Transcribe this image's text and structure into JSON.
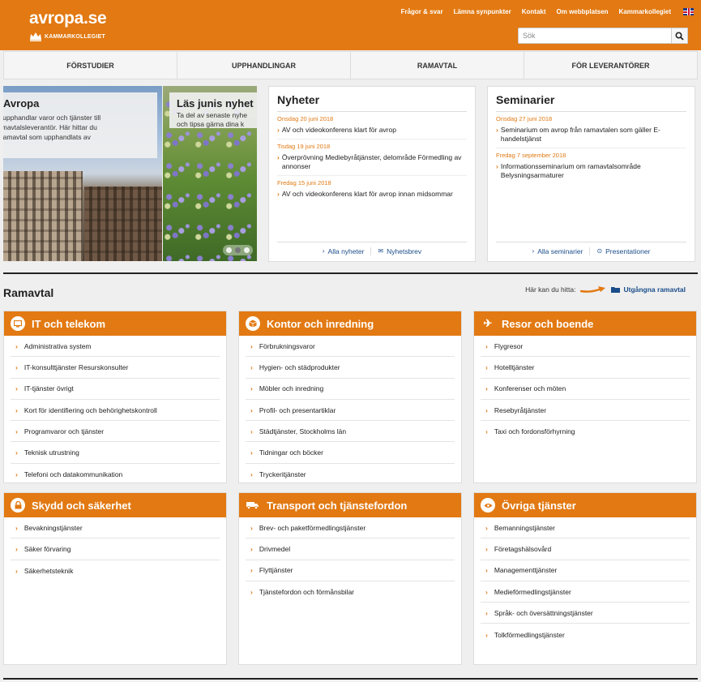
{
  "header": {
    "logo_title": "avropa.se",
    "logo_subtitle": "KAMMARKOLLEGIET",
    "top_links": [
      "Frågor & svar",
      "Lämna synpunkter",
      "Kontakt",
      "Om webbplatsen",
      "Kammarkollegiet"
    ],
    "search_placeholder": "Sök",
    "brand_color": "#e27912"
  },
  "nav": [
    "FÖRSTUDIER",
    "UPPHANDLINGAR",
    "RAMAVTAL",
    "FÖR LEVERANTÖRER"
  ],
  "hero": {
    "slide1_title": "Avropa",
    "slide1_lines": [
      "om upphandlar varor och tjänster till",
      "r ramavtalsleverantör. Här hittar du",
      "ga ramavtal som upphandlats av"
    ],
    "slide2_title": "Läs junis nyhet",
    "slide2_lines": [
      "Ta del av senaste nyhe",
      "och tipsa gärna dina k"
    ]
  },
  "news": {
    "title": "Nyheter",
    "items": [
      {
        "date": "Onsdag 20 juni 2018",
        "text": "AV och videokonferens klart för avrop"
      },
      {
        "date": "Tisdag 19 juni 2018",
        "text": "Överprövning Mediebyråtjänster, delområde Förmedling av annonser"
      },
      {
        "date": "Fredag 15 juni 2018",
        "text": "AV och videokonferens klart för avrop innan midsommar"
      }
    ],
    "footer_links": [
      "Alla nyheter",
      "Nyhetsbrev"
    ]
  },
  "seminars": {
    "title": "Seminarier",
    "items": [
      {
        "date": "Onsdag 27 juni 2018",
        "text": "Seminarium om avrop från ramavtalen som gäller E-handelstjänst"
      },
      {
        "date": "Fredag 7 september 2018",
        "text": "Informationsseminarium om ramavtalsområde Belysningsarmaturer"
      }
    ],
    "footer_links": [
      "Alla seminarier",
      "Presentationer"
    ]
  },
  "ramavtal": {
    "title": "Ramavtal",
    "hint_label": "Här kan du hitta:",
    "hint_link": "Utgångna ramavtal",
    "categories": [
      {
        "title": "IT och telekom",
        "icon": "monitor-icon",
        "items": [
          "Administrativa system",
          "IT-konsulttjänster Resurskonsulter",
          "IT-tjänster övrigt",
          "Kort för identifiering och behörighetskontroll",
          "Programvaror och tjänster",
          "Teknisk utrustning",
          "Telefoni och datakommunikation"
        ]
      },
      {
        "title": "Kontor och inredning",
        "icon": "box-icon",
        "items": [
          "Förbrukningsvaror",
          "Hygien- och städprodukter",
          "Möbler och inredning",
          "Profil- och presentartiklar",
          "Städtjänster, Stockholms län",
          "Tidningar och böcker",
          "Tryckeritjänster"
        ]
      },
      {
        "title": "Resor och boende",
        "icon": "airplane-icon",
        "items": [
          "Flygresor",
          "Hotelltjänster",
          "Konferenser och möten",
          "Resebyråtjänster",
          "Taxi och fordonsförhyrning"
        ]
      },
      {
        "title": "Skydd och säkerhet",
        "icon": "lock-icon",
        "items": [
          "Bevakningstjänster",
          "Säker förvaring",
          "Säkerhetsteknik"
        ]
      },
      {
        "title": "Transport och tjänstefordon",
        "icon": "truck-icon",
        "items": [
          "Brev- och paketförmedlingstjänster",
          "Drivmedel",
          "Flyttjänster",
          "Tjänstefordon och förmånsbilar"
        ]
      },
      {
        "title": "Övriga tjänster",
        "icon": "eye-icon",
        "items": [
          "Bemanningstjänster",
          "Företagshälsovård",
          "Managementtjänster",
          "Medieförmedlingstjänster",
          "Språk- och översättningstjänster",
          "Tolkförmedlingstjänster"
        ]
      }
    ]
  }
}
